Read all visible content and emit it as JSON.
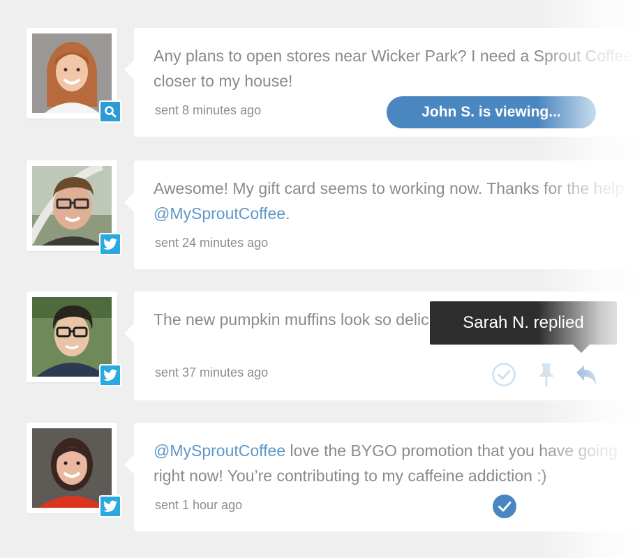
{
  "messages": [
    {
      "text": "Any plans to open stores near Wicker Park? I need a Sprout Coffee",
      "text_line2": "closer to my house!",
      "time": "sent 8 minutes ago",
      "network": "search-icon"
    },
    {
      "text": "Awesome! My gift card seems to working now. Thanks for the help",
      "mention": "@MySproutCoffee",
      "text_after_mention": ".",
      "time": "sent 24 minutes ago",
      "network": "twitter-icon"
    },
    {
      "text": "The new pumpkin muffins look so delicious @MySproutCoffee :)",
      "time": "sent 37 minutes ago",
      "network": "twitter-icon"
    },
    {
      "mention": "@MySproutCoffee",
      "text": " love the BYGO promotion that you have going",
      "text_line2": "right now! You’re contributing to my caffeine addiction :)",
      "time": "sent 1 hour ago",
      "network": "twitter-icon"
    }
  ],
  "viewing_pill": "John S. is viewing...",
  "tooltip": "Sarah N. replied",
  "colors": {
    "accent": "#4a86c0",
    "twitter": "#2aa9e0",
    "mention": "#5c97c8",
    "tooltip_bg": "#2d2d2d"
  }
}
